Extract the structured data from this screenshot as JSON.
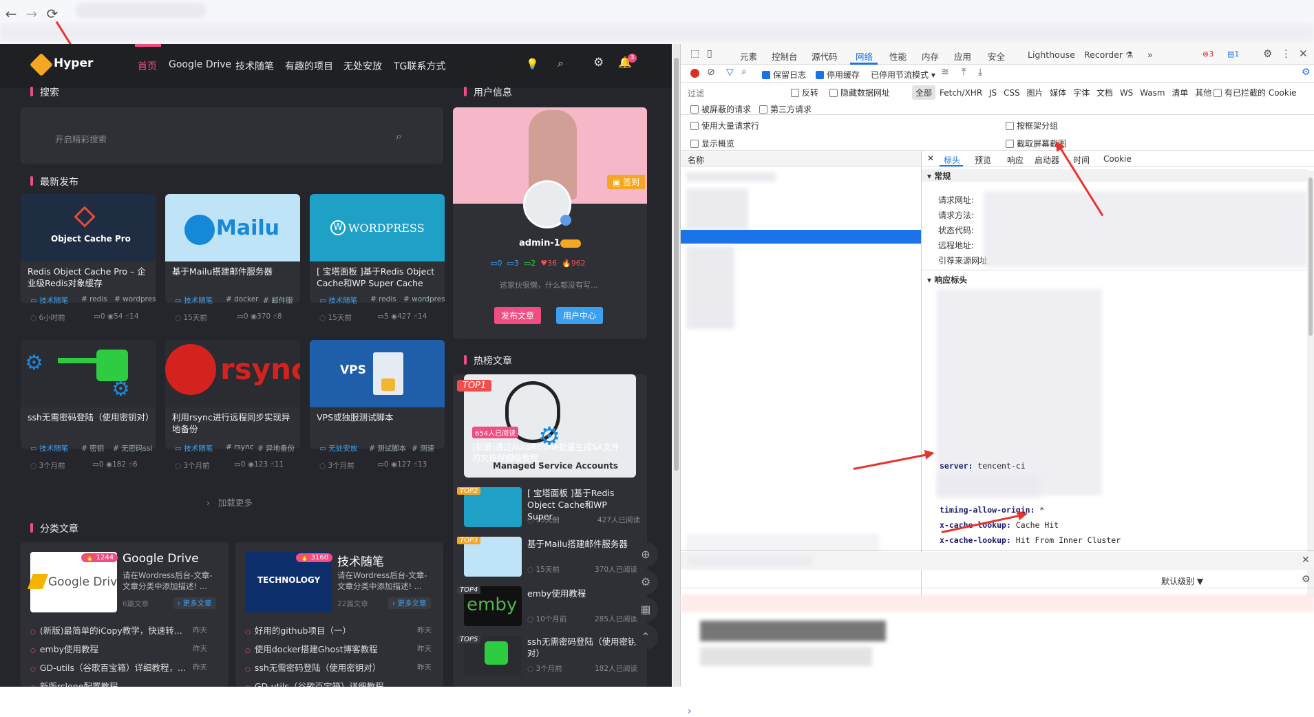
{
  "browser": {
    "back": "←",
    "forward": "→",
    "reload": "⟳"
  },
  "site": {
    "logo": "Hyper",
    "menu": [
      "首页",
      "Google Drive",
      "技术随笔",
      "有趣的项目",
      "无处安放",
      "TG联系方式"
    ],
    "bell_count": "3",
    "search_section": "搜索",
    "search_placeholder": "开启精彩搜索",
    "latest_section": "最新发布",
    "posts": [
      {
        "thumb": "Object Cache Pro",
        "title": "Redis Object Cache Pro – 企业级Redis对象缓存wordpress...",
        "cat": "技术随笔",
        "tags": [
          "# redis",
          "# wordpres"
        ],
        "time": "6小时前",
        "c": "0",
        "v": "54",
        "l": "14"
      },
      {
        "thumb": "Mailu",
        "title": "基于Mailu搭建邮件服务器",
        "cat": "技术随笔",
        "tags": [
          "# docker",
          "# 邮件服"
        ],
        "time": "15天前",
        "c": "0",
        "v": "370",
        "l": "8"
      },
      {
        "thumb": "WORDPRESS",
        "title": "[ 宝塔面板 ]基于Redis Object Cache和WP Super Cache的...",
        "cat": "技术随笔",
        "tags": [
          "# redis",
          "# wordpres"
        ],
        "time": "15天前",
        "c": "5",
        "v": "427",
        "l": "14"
      },
      {
        "thumb": "",
        "title": "ssh无需密码登陆（使用密钥对）",
        "cat": "技术随笔",
        "tags": [
          "# 密钥",
          "# 无密码ssi"
        ],
        "time": "3个月前",
        "c": "0",
        "v": "182",
        "l": "6"
      },
      {
        "thumb": "rsync",
        "title": "利用rsync进行远程同步实现异地备份",
        "cat": "技术随笔",
        "tags": [
          "# rsync",
          "# 异地备份"
        ],
        "time": "3个月前",
        "c": "0",
        "v": "123",
        "l": "11"
      },
      {
        "thumb": "VPS",
        "title": "VPS或独服测试脚本",
        "cat": "无处安放",
        "tags": [
          "# 测试脚本",
          "# 测速"
        ],
        "time": "3个月前",
        "c": "0",
        "v": "127",
        "l": "13"
      }
    ],
    "load_more": "加载更多",
    "cat_section": "分类文章",
    "cats": [
      {
        "name": "Google Drive",
        "badge": "🔥 1244",
        "desc": "请在Wordress后台-文章-文章分类中添加描述! ...",
        "count": "6篇文章",
        "more": "更多文章",
        "thumb": "Google Drive",
        "items": [
          "(新版)最简单的iCopy教学，快速转...",
          "emby使用教程",
          "GD-utils（谷歌百宝箱）详细教程，...",
          "新版rclone配置教程"
        ],
        "time": "昨天"
      },
      {
        "name": "技术随笔",
        "badge": "🔥 3160",
        "desc": "请在Wordress后台-文章-文章分类中添加描述! ...",
        "count": "22篇文章",
        "more": "更多文章",
        "thumb": "TECHNOLOGY",
        "items": [
          "好用的github项目（一）",
          "使用docker搭建Ghost博客教程",
          "ssh无需密码登陆（使用密钥对）",
          "GD-utils（谷歌百宝箱）详细教程"
        ],
        "time": "昨天"
      }
    ],
    "user_section": "用户信息",
    "sign": "签到",
    "username": "admin-1",
    "stats": [
      "0",
      "3",
      "2",
      "36",
      "962"
    ],
    "motto": "这家伙很懒，什么都没有写...",
    "btn_post": "发布文章",
    "btn_user": "用户中心",
    "hot_section": "热榜文章",
    "hot": [
      {
        "rank": "TOP1",
        "title": "(新版)通过AutoRclone批量生成SA文件的究极保姆级教程",
        "reads": "654人已阅读"
      },
      {
        "rank": "TOP2",
        "title": "[ 宝塔面板 ]基于Redis Object Cache和WP Super...",
        "time": "15天前",
        "reads": "427人已阅读"
      },
      {
        "rank": "TOP3",
        "title": "基于Mailu搭建邮件服务器",
        "time": "15天前",
        "reads": "370人已阅读"
      },
      {
        "rank": "TOP4",
        "title": "emby使用教程",
        "time": "10个月前",
        "reads": "285人已阅读"
      },
      {
        "rank": "TOP5",
        "title": "ssh无需密码登陆（使用密钥对）",
        "time": "3个月前",
        "reads": "182人已阅读"
      }
    ],
    "top1_caption": "Managed Service Accounts"
  },
  "devtools": {
    "tabs": [
      "元素",
      "控制台",
      "源代码",
      "网络",
      "性能",
      "内存",
      "应用",
      "安全",
      "Lighthouse",
      "Recorder ⚗"
    ],
    "err": "3",
    "info": "1",
    "preserve_log": "保留日志",
    "disable_cache": "停用缓存",
    "throttle": "已停用节流模式",
    "filter_placeholder": "过滤",
    "invert": "反转",
    "hide_data": "隐藏数据网址",
    "all": "全部",
    "types": [
      "Fetch/XHR",
      "JS",
      "CSS",
      "图片",
      "媒体",
      "字体",
      "文档",
      "WS",
      "Wasm",
      "清单",
      "其他"
    ],
    "blocked_cookies": "有已拦截的 Cookie",
    "blocked_req": "被屏蔽的请求",
    "third_party": "第三方请求",
    "big_rows": "使用大量请求行",
    "group_frame": "按框架分组",
    "overview": "显示概览",
    "screenshot": "截取屏幕截图",
    "name_col": "名称",
    "detail_tabs": [
      "标头",
      "预览",
      "响应",
      "启动器",
      "时间",
      "Cookie"
    ],
    "general": "常规",
    "general_rows": [
      "请求网址:",
      "请求方法:",
      "状态代码:",
      "远程地址:",
      "引荐来源网址"
    ],
    "resp_headers": "响应标头",
    "h_server": "server:",
    "v_server": "tencent-ci",
    "h_tao": "timing-allow-origin:",
    "v_tao": "*",
    "h_xc1": "x-cache-lookup:",
    "v_xc1": "Cache Hit",
    "h_xc2": "x-cache-lookup:",
    "v_xc2": "Hit From Inner Cluster",
    "level": "默认级别 ▼",
    "prompt": "›"
  }
}
